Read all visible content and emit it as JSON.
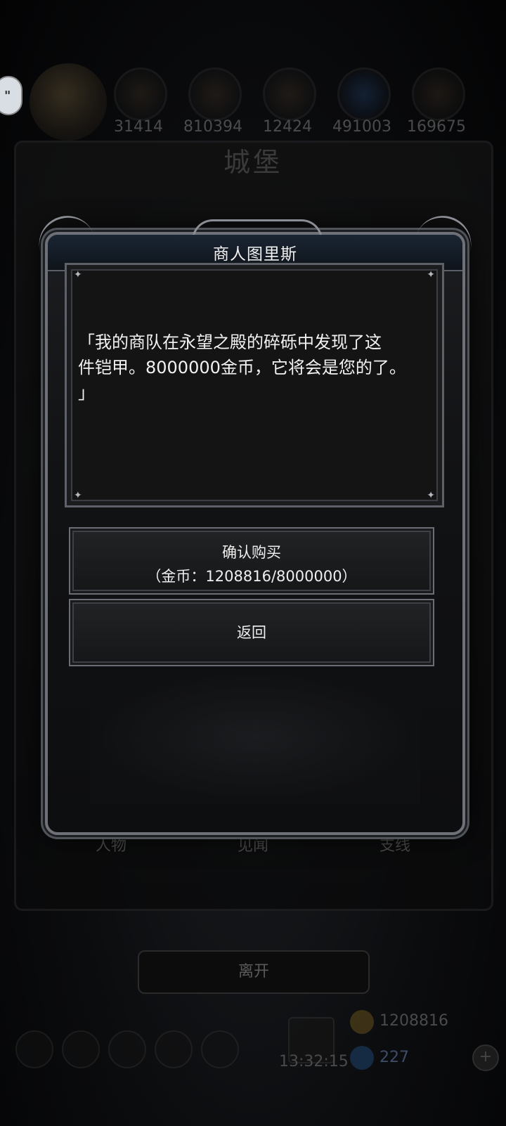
{
  "resources": {
    "values": [
      "31414",
      "810394",
      "12424",
      "491003",
      "169675"
    ]
  },
  "castle": {
    "title": "城堡"
  },
  "bottom_tabs": {
    "characters": "人物",
    "journal": "见闻",
    "side": "支线"
  },
  "leave_button": "离开",
  "footer": {
    "timer": "13:32:15",
    "gold": "1208816",
    "gems": "227"
  },
  "modal": {
    "title": "商人图里斯",
    "dialog_line1": "「我的商队在永望之殿的碎砾中发现了这",
    "dialog_line2": "件铠甲。8000000金币，它将会是您的了。",
    "dialog_line3": "」",
    "confirm_label": "确认购买",
    "confirm_sub": "（金币：1208816/8000000）",
    "back_label": "返回"
  }
}
